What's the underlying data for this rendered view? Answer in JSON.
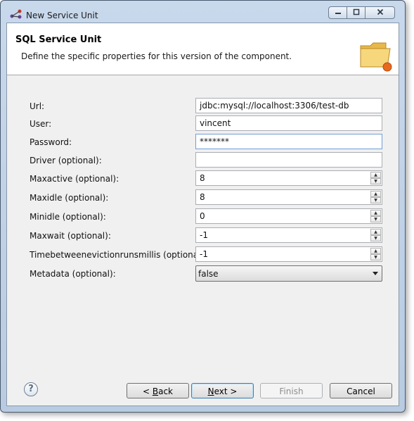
{
  "window": {
    "title": "New Service Unit",
    "controls": {
      "minimize": "▭",
      "maximize": "▢",
      "close": "✕"
    }
  },
  "banner": {
    "title": "SQL Service Unit",
    "description": "Define the specific properties for this version of the component.",
    "icon": "folder-icon"
  },
  "form": {
    "url": {
      "label": "Url:",
      "value": "jdbc:mysql://localhost:3306/test-db"
    },
    "user": {
      "label": "User:",
      "value": "vincent"
    },
    "password": {
      "label": "Password:",
      "value": "*******"
    },
    "driver": {
      "label": "Driver (optional):",
      "value": ""
    },
    "maxactive": {
      "label": "Maxactive (optional):",
      "value": "8"
    },
    "maxidle": {
      "label": "Maxidle (optional):",
      "value": "8"
    },
    "minidle": {
      "label": "Minidle (optional):",
      "value": "0"
    },
    "maxwait": {
      "label": "Maxwait (optional):",
      "value": "-1"
    },
    "timebetween": {
      "label": "Timebetweenevictionrunsmillis (optional):",
      "value": "-1"
    },
    "metadata": {
      "label": "Metadata (optional):",
      "value": "false"
    }
  },
  "buttons": {
    "help": "?",
    "back": {
      "mnemonic": "B",
      "rest": "ack",
      "prefix": "< "
    },
    "next": {
      "mnemonic": "N",
      "rest": "ext >",
      "prefix": ""
    },
    "finish": "Finish",
    "cancel": "Cancel"
  },
  "colors": {
    "titlebar": "#c9d9ec",
    "client_bg": "#f0f0f0",
    "focus_border": "#6f9ed9"
  }
}
